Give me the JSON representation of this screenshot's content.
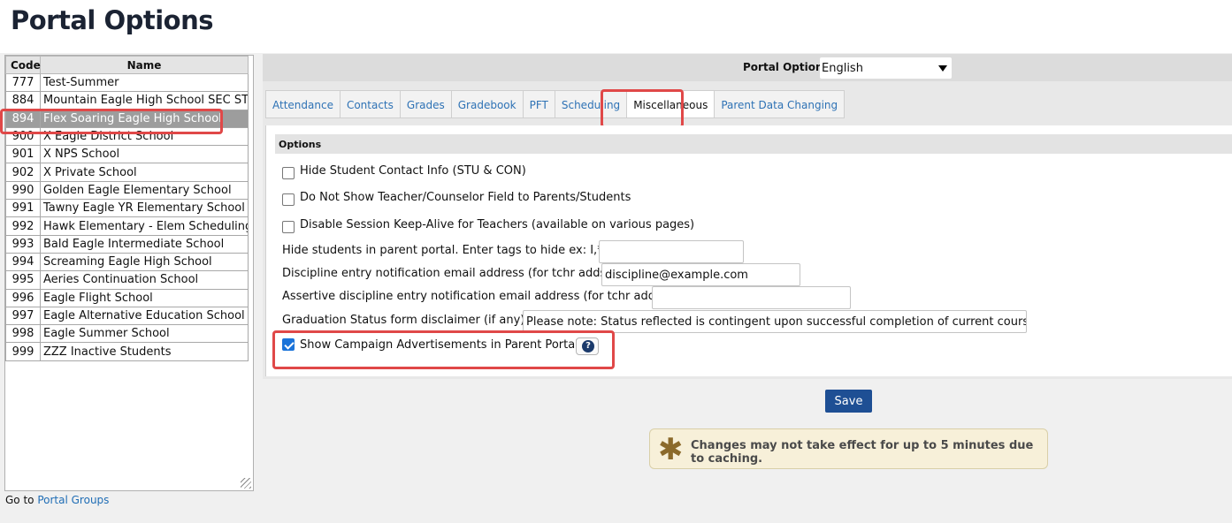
{
  "page_title": "Portal Options",
  "schools": {
    "headers": {
      "code": "Code",
      "name": "Name"
    },
    "rows": [
      {
        "code": "777",
        "name": "Test-Summer"
      },
      {
        "code": "884",
        "name": "Mountain Eagle High School SEC STF"
      },
      {
        "code": "894",
        "name": "Flex Soaring Eagle High School",
        "selected": true
      },
      {
        "code": "900",
        "name": "X Eagle District School"
      },
      {
        "code": "901",
        "name": "X NPS School"
      },
      {
        "code": "902",
        "name": "X Private School"
      },
      {
        "code": "990",
        "name": "Golden Eagle Elementary School"
      },
      {
        "code": "991",
        "name": "Tawny Eagle YR Elementary School"
      },
      {
        "code": "992",
        "name": "Hawk Elementary - Elem Scheduling"
      },
      {
        "code": "993",
        "name": "Bald Eagle Intermediate School"
      },
      {
        "code": "994",
        "name": "Screaming Eagle High School"
      },
      {
        "code": "995",
        "name": "Aeries Continuation School"
      },
      {
        "code": "996",
        "name": "Eagle Flight School"
      },
      {
        "code": "997",
        "name": "Eagle Alternative Education School"
      },
      {
        "code": "998",
        "name": "Eagle Summer School"
      },
      {
        "code": "999",
        "name": "ZZZ Inactive Students"
      }
    ]
  },
  "goto": {
    "prefix": "Go to",
    "link": "Portal Groups"
  },
  "portal_options": {
    "label": "Portal Options:",
    "language": "English"
  },
  "tabs": [
    {
      "label": "Attendance"
    },
    {
      "label": "Contacts"
    },
    {
      "label": "Grades"
    },
    {
      "label": "Gradebook"
    },
    {
      "label": "PFT"
    },
    {
      "label": "Scheduling"
    },
    {
      "label": "Miscellaneous",
      "active": true
    },
    {
      "label": "Parent Data Changing"
    }
  ],
  "options": {
    "section_title": "Options",
    "hide_contact_info": {
      "label": "Hide Student Contact Info (STU & CON)",
      "checked": false
    },
    "hide_teacher_field": {
      "label": "Do Not Show Teacher/Counselor Field to Parents/Students",
      "checked": false
    },
    "disable_keepalive": {
      "label": "Disable Session Keep-Alive for Teachers (available on various pages)",
      "checked": false
    },
    "hide_students": {
      "label": "Hide students in parent portal. Enter tags to hide ex: I,*,N",
      "value": ""
    },
    "discipline_email": {
      "label": "Discipline entry notification email address (for tchr adds):",
      "value": "discipline@example.com"
    },
    "assertive_email": {
      "label": "Assertive discipline entry notification email address (for tchr adds):",
      "value": ""
    },
    "graduation_disclaimer": {
      "label": "Graduation Status form disclaimer (if any):",
      "value": "Please note: Status reflected is contingent upon successful completion of current course enro"
    },
    "campaign_ads": {
      "label": "Show Campaign Advertisements in Parent Portal",
      "checked": true,
      "help_icon": "question-circle-icon"
    }
  },
  "save_label": "Save",
  "notice": {
    "icon": "asterisk-icon",
    "text": "Changes may not take effect for up to 5 minutes due to caching."
  },
  "colors": {
    "accent": "#1e4f94",
    "highlight": "#e04848",
    "link": "#2e72b5"
  }
}
